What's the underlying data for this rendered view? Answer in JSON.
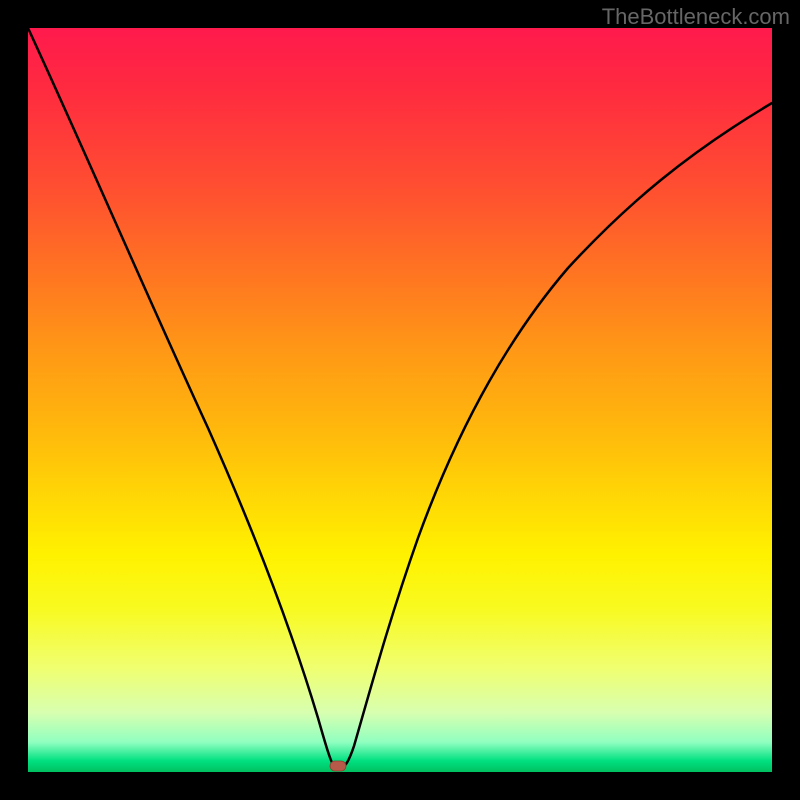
{
  "watermark": "TheBottleneck.com",
  "chart_data": {
    "type": "line",
    "title": "",
    "xlabel": "",
    "ylabel": "",
    "xlim": [
      0,
      100
    ],
    "ylim": [
      0,
      100
    ],
    "grid": false,
    "legend": false,
    "gradient_colors": {
      "top": "#ff1a4d",
      "mid_upper": "#ff7820",
      "mid": "#fff200",
      "mid_lower": "#d8ffb0",
      "bottom": "#00c060"
    },
    "series": [
      {
        "name": "bottleneck-curve",
        "color": "#000000",
        "x": [
          0,
          5,
          10,
          15,
          20,
          25,
          30,
          35,
          38,
          40,
          41,
          42,
          45,
          50,
          55,
          60,
          65,
          70,
          75,
          80,
          85,
          90,
          95,
          100
        ],
        "y": [
          100,
          88,
          75,
          63,
          50,
          40,
          28,
          13,
          4,
          0,
          0,
          2,
          13,
          30,
          43,
          52,
          59,
          65,
          70,
          74,
          77,
          80,
          82,
          84
        ]
      }
    ],
    "marker": {
      "name": "optimal-point",
      "x": 41,
      "y": 0.5,
      "color": "#c06050",
      "shape": "rounded-rect"
    }
  }
}
